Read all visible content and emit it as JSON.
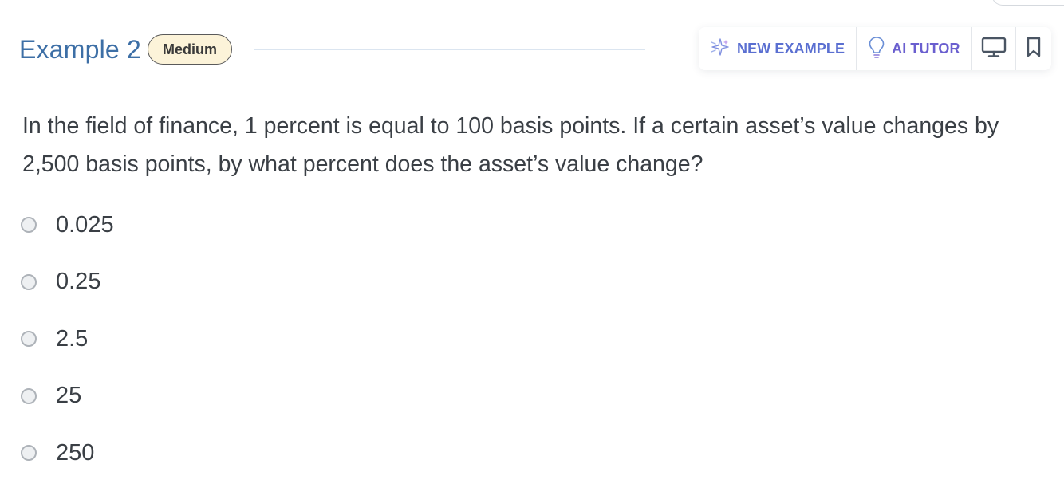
{
  "header": {
    "title": "Example 2",
    "difficulty": "Medium"
  },
  "toolbar": {
    "new_example_label": "NEW EXAMPLE",
    "ai_tutor_label": "AI TUTOR"
  },
  "question": {
    "text": "In the field of finance, 1 percent is equal to 100 basis points. If a certain asset’s value changes by 2,500 basis points, by what percent does the asset’s value change?"
  },
  "options": [
    {
      "label": "0.025"
    },
    {
      "label": "0.25"
    },
    {
      "label": "2.5"
    },
    {
      "label": "25"
    },
    {
      "label": "250"
    }
  ],
  "icons": {
    "new_example": "sparkle-icon",
    "ai_tutor": "lightbulb-icon",
    "monitor": "monitor-icon",
    "bookmark": "bookmark-icon"
  },
  "colors": {
    "title": "#3d6fa6",
    "badge_bg": "#fcf3d9",
    "new_example": "#5a6fd1",
    "ai_tutor": "#6a5fcf"
  }
}
